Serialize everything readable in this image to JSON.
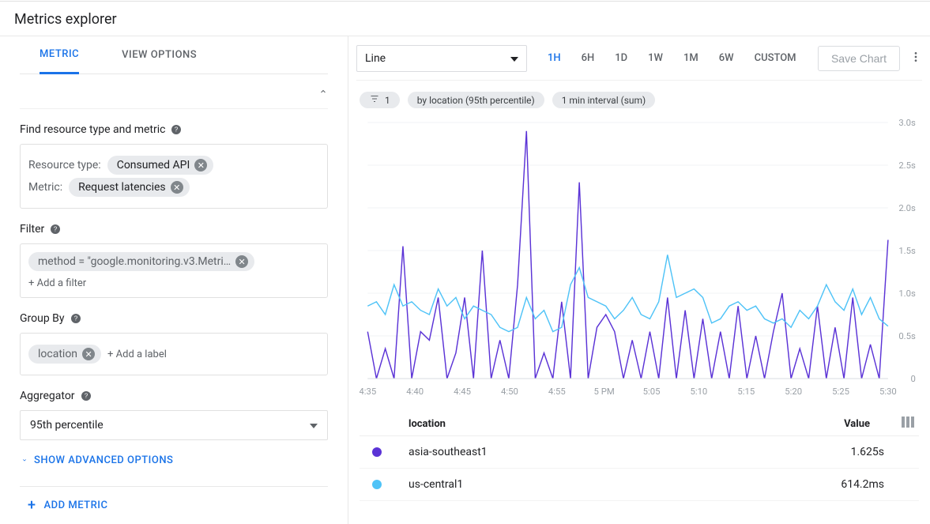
{
  "page_title": "Metrics explorer",
  "tabs": {
    "metric": "Metric",
    "view_options": "View Options"
  },
  "form": {
    "find_label": "Find resource type and metric",
    "resource_type_label": "Resource type:",
    "resource_type_value": "Consumed API",
    "metric_label": "Metric:",
    "metric_value": "Request latencies",
    "filter_label": "Filter",
    "filter_chip": "method = \"google.monitoring.v3.Metri…",
    "add_filter": "+ Add a filter",
    "group_by_label": "Group By",
    "group_chip": "location",
    "add_label": "+ Add a label",
    "aggregator_label": "Aggregator",
    "aggregator_value": "95th percentile",
    "show_advanced": "SHOW ADVANCED OPTIONS",
    "add_metric": "ADD METRIC"
  },
  "toolbar": {
    "chart_type": "Line",
    "ranges": [
      "1H",
      "6H",
      "1D",
      "1W",
      "1M",
      "6W",
      "CUSTOM"
    ],
    "active_range": "1H",
    "save": "Save Chart"
  },
  "pills": {
    "filter_count": "1",
    "group": "by location (95th percentile)",
    "interval": "1 min interval (sum)"
  },
  "legend": {
    "location_header": "location",
    "value_header": "Value",
    "rows": [
      {
        "color": "#5b33d6",
        "name": "asia-southeast1",
        "value": "1.625s"
      },
      {
        "color": "#4fc3f7",
        "name": "us-central1",
        "value": "614.2ms"
      }
    ]
  },
  "chart_data": {
    "type": "line",
    "xlabel": "",
    "ylabel": "",
    "ylim": [
      0,
      3.0
    ],
    "y_ticks": [
      "0",
      "0.5s",
      "1.0s",
      "1.5s",
      "2.0s",
      "2.5s",
      "3.0s"
    ],
    "x_ticks": [
      "4:35",
      "4:40",
      "4:45",
      "4:50",
      "4:55",
      "5 PM",
      "5:05",
      "5:10",
      "5:15",
      "5:20",
      "5:25",
      "5:30"
    ],
    "x": [
      0,
      1,
      2,
      3,
      4,
      5,
      6,
      7,
      8,
      9,
      10,
      11,
      12,
      13,
      14,
      15,
      16,
      17,
      18,
      19,
      20,
      21,
      22,
      23,
      24,
      25,
      26,
      27,
      28,
      29,
      30,
      31,
      32,
      33,
      34,
      35,
      36,
      37,
      38,
      39,
      40,
      41,
      42,
      43,
      44,
      45,
      46,
      47,
      48,
      49,
      50,
      51,
      52,
      53,
      54,
      55,
      56,
      57,
      58,
      59
    ],
    "series": [
      {
        "name": "asia-southeast1",
        "color": "#5b33d6",
        "values": [
          0.55,
          0.0,
          0.35,
          0.0,
          1.55,
          0.0,
          0.55,
          0.45,
          0.95,
          0.0,
          0.3,
          0.95,
          0.0,
          1.5,
          0.0,
          0.45,
          0.0,
          1.1,
          2.9,
          0.0,
          0.3,
          0.0,
          0.9,
          0.0,
          2.3,
          0.0,
          0.6,
          0.75,
          0.55,
          0.0,
          0.45,
          0.0,
          0.55,
          0.0,
          0.95,
          0.0,
          0.8,
          0.0,
          0.7,
          0.0,
          0.55,
          0.0,
          0.85,
          0.0,
          0.5,
          0.0,
          0.55,
          1.0,
          0.0,
          0.35,
          0.0,
          0.85,
          0.0,
          0.6,
          0.0,
          0.95,
          0.0,
          0.4,
          0.0,
          1.625
        ]
      },
      {
        "name": "us-central1",
        "color": "#4fc3f7",
        "values": [
          0.85,
          0.9,
          0.75,
          1.1,
          0.85,
          0.9,
          0.8,
          0.75,
          1.05,
          0.85,
          0.95,
          0.7,
          0.85,
          0.8,
          0.75,
          0.6,
          0.55,
          0.6,
          0.95,
          0.7,
          0.8,
          0.55,
          0.6,
          1.1,
          1.3,
          0.95,
          0.9,
          0.85,
          0.7,
          0.8,
          0.95,
          0.75,
          0.7,
          0.9,
          1.45,
          0.95,
          1.0,
          1.05,
          0.95,
          0.65,
          0.7,
          0.85,
          0.9,
          0.8,
          0.85,
          0.7,
          0.65,
          0.7,
          0.6,
          0.8,
          0.7,
          0.85,
          1.1,
          0.9,
          0.8,
          1.05,
          0.75,
          0.95,
          0.7,
          0.614
        ]
      }
    ]
  }
}
